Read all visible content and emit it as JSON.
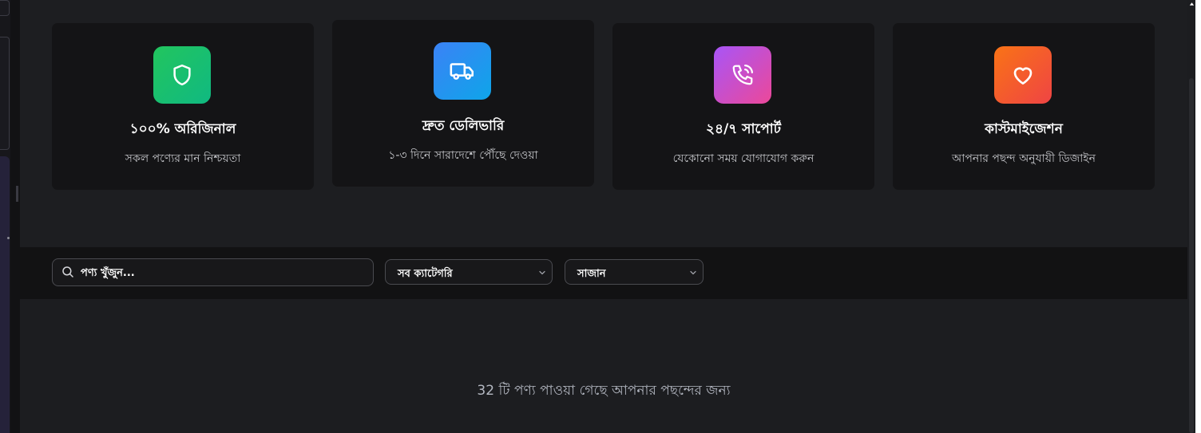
{
  "features": [
    {
      "icon": "shield-icon",
      "title": "১০০% অরিজিনাল",
      "subtitle": "সকল পণ্যের মান নিশ্চয়তা",
      "gradient": [
        "#22c55e",
        "#10b981"
      ]
    },
    {
      "icon": "truck-icon",
      "title": "দ্রুত ডেলিভারি",
      "subtitle": "১-৩ দিনে সারাদেশে পৌঁছে দেওয়া",
      "gradient": [
        "#3b82f6",
        "#0ea5e9"
      ]
    },
    {
      "icon": "phone-icon",
      "title": "২৪/৭ সাপোর্ট",
      "subtitle": "যেকোনো সময় যোগাযোগ করুন",
      "gradient": [
        "#a855f7",
        "#ec4899"
      ]
    },
    {
      "icon": "heart-icon",
      "title": "কাস্টমাইজেশন",
      "subtitle": "আপনার পছন্দ অনুযায়ী ডিজাইন",
      "gradient": [
        "#f97316",
        "#ef4444"
      ]
    }
  ],
  "toolbar": {
    "search_placeholder": "পণ্য খুঁজুন...",
    "category_selected": "সব ক্যাটেগরি",
    "sort_selected": "সাজান"
  },
  "results": {
    "summary": "32 টি পণ্য পাওয়া গেছে আপনার পছন্দের জন্য"
  }
}
